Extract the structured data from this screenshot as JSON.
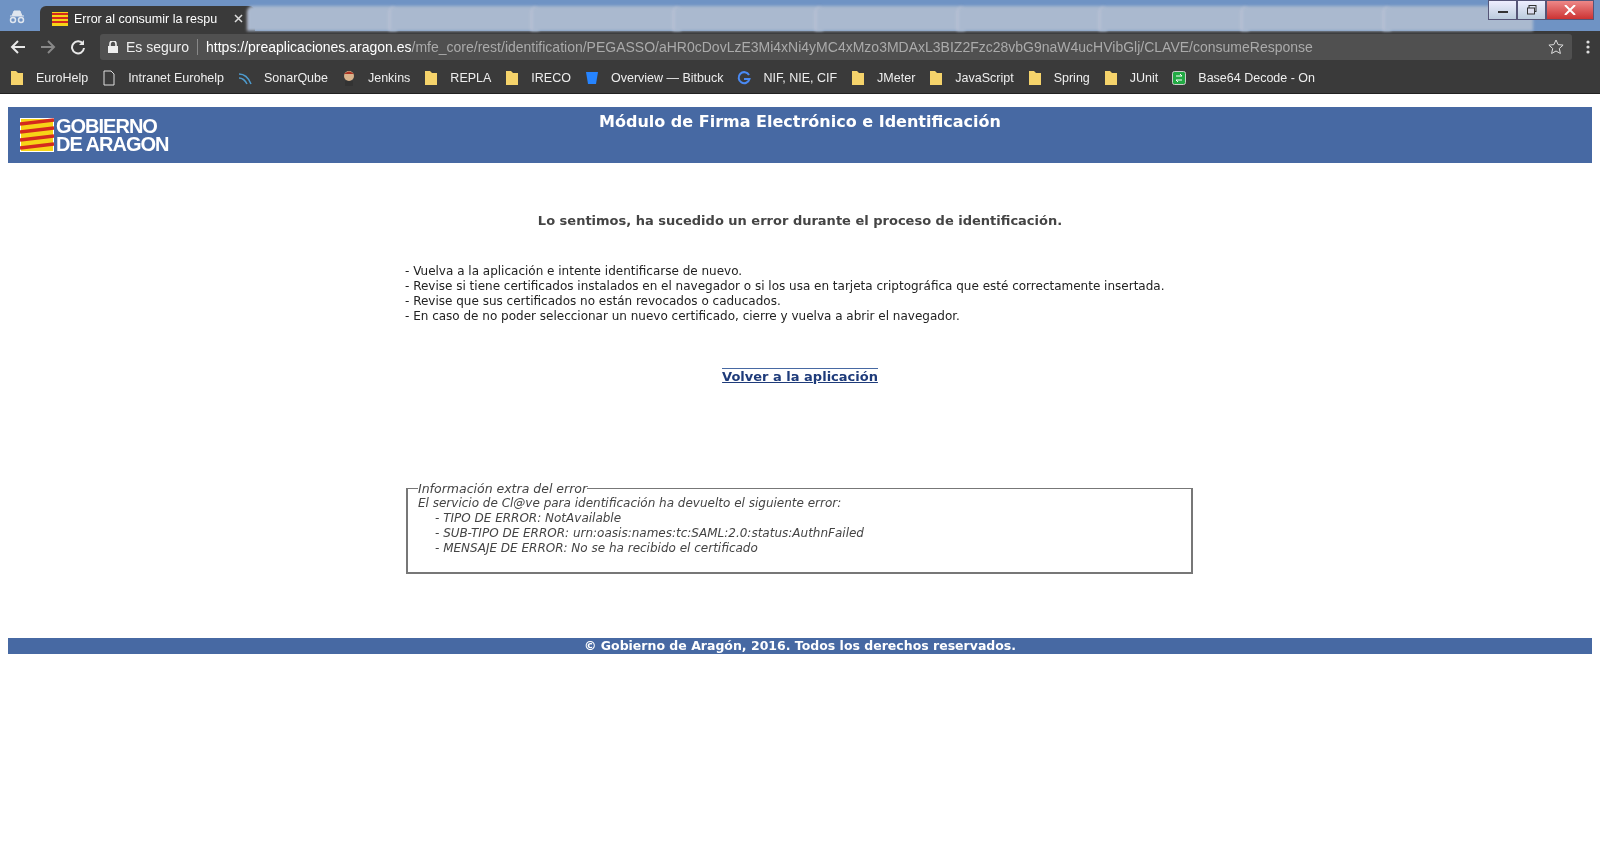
{
  "browser": {
    "tabs": [
      {
        "title": "Error al consumir la respu",
        "selected": true
      },
      {
        "selected": false
      },
      {
        "selected": false
      },
      {
        "selected": false
      },
      {
        "selected": false
      },
      {
        "selected": false
      },
      {
        "selected": false
      },
      {
        "selected": false
      },
      {
        "selected": false
      },
      {
        "selected": false
      }
    ],
    "security": "Es seguro",
    "url_host": "https://preaplicaciones.aragon.es",
    "url_path": "/mfe_core/rest/identification/PEGASSO/aHR0cDovLzE3Mi4xNi4yMC4xMzo3MDAxL3BIZ2Fzc28vbG9naW4ucHVibGlj/CLAVE/consumeResponse",
    "bookmarks": [
      {
        "label": "EuroHelp",
        "kind": "folder"
      },
      {
        "label": "Intranet Eurohelp",
        "kind": "page"
      },
      {
        "label": "SonarQube",
        "kind": "sonar"
      },
      {
        "label": "Jenkins",
        "kind": "jenkins"
      },
      {
        "label": "REPLA",
        "kind": "folder"
      },
      {
        "label": "IRECO",
        "kind": "folder"
      },
      {
        "label": "Overview — Bitbuck",
        "kind": "bitbucket"
      },
      {
        "label": "NIF, NIE, CIF",
        "kind": "google"
      },
      {
        "label": "JMeter",
        "kind": "folder"
      },
      {
        "label": "JavaScript",
        "kind": "folder"
      },
      {
        "label": "Spring",
        "kind": "folder"
      },
      {
        "label": "JUnit",
        "kind": "folder"
      },
      {
        "label": "Base64 Decode - On",
        "kind": "base64"
      }
    ]
  },
  "header": {
    "logo_line_1": "GOBIERNO",
    "logo_line_2": "DE ARAGON",
    "title": "Módulo de Firma Electrónico e Identificación"
  },
  "error_heading": "Lo sentimos, ha sucedido un error durante el proceso de identificación.",
  "instructions": [
    "- Vuelva a la aplicación e intente identificarse de nuevo.",
    "- Revise si tiene certificados instalados en el navegador o si los usa en tarjeta criptográfica que esté correctamente insertada.",
    "- Revise que sus certificados no están revocados o caducados.",
    "- En caso de no poder seleccionar un nuevo certificado, cierre y vuelva a abrir el navegador."
  ],
  "back_link": "Volver a la aplicación",
  "extra_info": {
    "legend": "Información extra del error",
    "intro": "El servicio de Cl@ve para identificación ha devuelto el siguiente error:",
    "lines": [
      "- TIPO DE ERROR: NotAvailable",
      "- SUB-TIPO DE ERROR: urn:oasis:names:tc:SAML:2.0:status:AuthnFailed",
      "- MENSAJE DE ERROR: No se ha recibido el certificado"
    ]
  },
  "footer": "© Gobierno de Aragón, 2016. Todos los derechos reservados."
}
